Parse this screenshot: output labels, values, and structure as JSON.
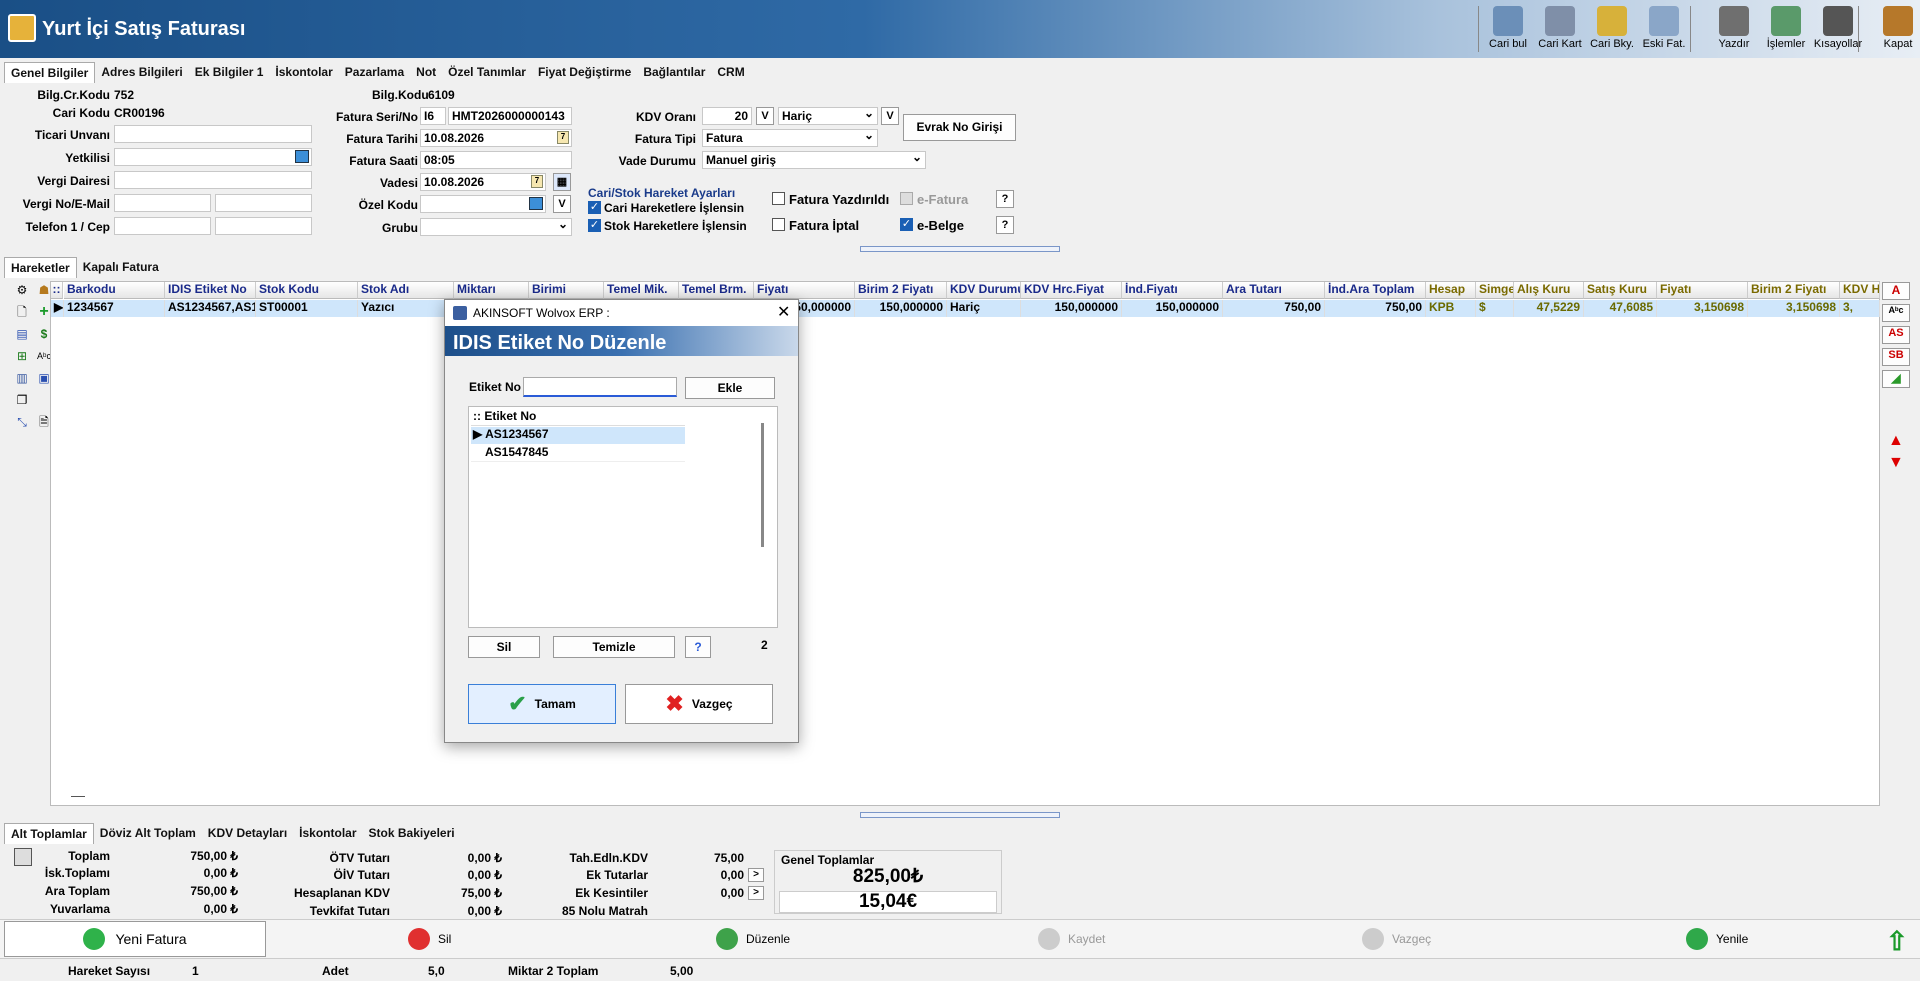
{
  "title": "Yurt İçi Satış Faturası",
  "toolbar": [
    {
      "label": "Cari bul",
      "icon": "cari-bul-icon"
    },
    {
      "label": "Cari Kart",
      "icon": "cari-kart-icon"
    },
    {
      "label": "Cari Bky.",
      "icon": "cari-bakiye-icon"
    },
    {
      "label": "Eski Fat.",
      "icon": "eski-fatura-icon"
    },
    {
      "label": "Yazdır",
      "icon": "printer-icon"
    },
    {
      "label": "İşlemler",
      "icon": "islemler-icon"
    },
    {
      "label": "Kısayollar",
      "icon": "keyboard-icon"
    },
    {
      "label": "Kapat",
      "icon": "door-exit-icon"
    }
  ],
  "top_tabs": [
    "Genel Bilgiler",
    "Adres Bilgileri",
    "Ek Bilgiler 1",
    "İskontolar",
    "Pazarlama",
    "Not",
    "Özel Tanımlar",
    "Fiyat Değiştirme",
    "Bağlantılar",
    "CRM"
  ],
  "form": {
    "bilg_cr_kodu_label": "Bilg.Cr.Kodu",
    "bilg_cr_kodu": "752",
    "bilg_kodu_label": "Bilg.Kodu",
    "bilg_kodu": "6109",
    "cari_kodu_label": "Cari Kodu",
    "cari_kodu": "CR00196",
    "ticari_unvan_label": "Ticari Unvanı",
    "yetkilisi_label": "Yetkilisi",
    "vergi_dairesi_label": "Vergi Dairesi",
    "vergi_no_label": "Vergi No/E-Mail",
    "telefon_label": "Telefon 1 / Cep",
    "fatura_seri_label": "Fatura Seri/No",
    "fatura_seri": "I6",
    "fatura_no": "HMT2026000000143",
    "fatura_tarihi_label": "Fatura Tarihi",
    "fatura_tarihi": "10.08.2026",
    "fatura_saati_label": "Fatura Saati",
    "fatura_saati": "08:05",
    "vadesi_label": "Vadesi",
    "vadesi": "10.08.2026",
    "ozel_kodu_label": "Özel Kodu",
    "grubu_label": "Grubu",
    "kdv_orani_label": "KDV Oranı",
    "kdv_orani": "20",
    "kdv_v": "V",
    "kdv_durum": "Hariç",
    "kdv_v2": "V",
    "fatura_tipi_label": "Fatura Tipi",
    "fatura_tipi": "Fatura",
    "vade_durumu_label": "Vade Durumu",
    "vade_durumu": "Manuel giriş",
    "evrak_no_btn": "Evrak No Girişi",
    "ozel_v": "V",
    "cari_stok_title": "Cari/Stok Hareket Ayarları",
    "cari_hareket": "Cari Hareketlere İşlensin",
    "stok_hareket": "Stok Hareketlere İşlensin",
    "fatura_yazdirildi": "Fatura Yazdırıldı",
    "fatura_iptal": "Fatura İptal",
    "e_fatura": "e-Fatura",
    "e_belge": "e-Belge",
    "help": "?"
  },
  "mid_tabs": [
    "Hareketler",
    "Kapalı Fatura"
  ],
  "grid": {
    "headers": [
      "Barkodu",
      "IDIS Etiket No",
      "Stok Kodu",
      "Stok Adı",
      "Miktarı",
      "Birimi",
      "Temel Mik.",
      "Temel Brm.",
      "Fiyatı",
      "Birim 2 Fiyatı",
      "KDV Durumu",
      "KDV Hrc.Fiyat",
      "İnd.Fiyatı",
      "Ara Tutarı",
      "İnd.Ara Toplam",
      "Hesap",
      "Simge",
      "Alış Kuru",
      "Satış Kuru",
      "Fiyatı",
      "Birim 2 Fiyatı",
      "KDV H"
    ],
    "row": [
      "1234567",
      "AS1234567,AS1",
      "ST00001",
      "Yazıcı",
      "",
      "",
      "",
      "",
      "150,000000",
      "150,000000",
      "Hariç",
      "150,000000",
      "150,000000",
      "750,00",
      "750,00",
      "KPB",
      "$",
      "47,5229",
      "47,6085",
      "3,150698",
      "3,150698",
      "3,"
    ]
  },
  "right_side": [
    "A",
    "AS",
    "SB"
  ],
  "dialog": {
    "window_title": "AKINSOFT Wolvox ERP :",
    "header": "IDIS Etiket No Düzenle",
    "etiket_label": "Etiket No",
    "etiket_value": "",
    "ekle": "Ekle",
    "list_header": "Etiket No",
    "items": [
      "AS1234567",
      "AS1547845"
    ],
    "sil": "Sil",
    "temizle": "Temizle",
    "count": "2",
    "tamam": "Tamam",
    "vazgec": "Vazgeç"
  },
  "bottom_tabs": [
    "Alt Toplamlar",
    "Döviz Alt Toplam",
    "KDV Detayları",
    "İskontolar",
    "Stok Bakiyeleri"
  ],
  "totals": {
    "toplam_l": "Toplam",
    "toplam": "750,00 ₺",
    "isk_l": "İsk.Toplamı",
    "isk": "0,00 ₺",
    "ara_l": "Ara Toplam",
    "ara": "750,00 ₺",
    "yuv_l": "Yuvarlama",
    "yuv": "0,00 ₺",
    "otv_l": "ÖTV Tutarı",
    "otv": "0,00 ₺",
    "oiv_l": "ÖİV Tutarı",
    "oiv": "0,00 ₺",
    "hkdv_l": "Hesaplanan KDV",
    "hkdv": "75,00 ₺",
    "tev_l": "Tevkifat Tutarı",
    "tev": "0,00 ₺",
    "tah_l": "Tah.Edln.KDV",
    "tah": "75,00",
    "ekt_l": "Ek Tutarlar",
    "ekt": "0,00",
    "eks_l": "Ek Kesintiler",
    "eks": "0,00",
    "m85_l": "85 Nolu Matrah",
    "genel_l": "Genel Toplamlar",
    "genel_tl": "825,00₺",
    "genel_eur": "15,04€"
  },
  "actions": [
    "Yeni Fatura",
    "Sil",
    "Düzenle",
    "Kaydet",
    "Vazgeç",
    "Yenile"
  ],
  "status": {
    "hareket_l": "Hareket Sayısı",
    "hareket": "1",
    "adet_l": "Adet",
    "adet": "5,0",
    "m2_l": "Miktar 2 Toplam",
    "m2": "5,00"
  }
}
